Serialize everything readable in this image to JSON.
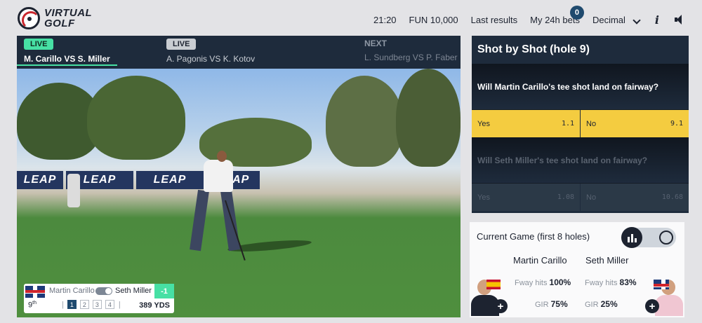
{
  "brand": {
    "line1": "VIRTUAL",
    "line2": "GOLF"
  },
  "header": {
    "time": "21:20",
    "balance": "FUN 10,000",
    "last_results": "Last results",
    "my_bets": "My 24h bets",
    "bets_count": "0",
    "odds_format": "Decimal",
    "icons": [
      "chevron-down-icon",
      "info-icon",
      "speaker-icon"
    ]
  },
  "games": [
    {
      "status": "LIVE",
      "name": "M. Carillo VS S. Miller",
      "active": true
    },
    {
      "status": "LIVE",
      "name": "A. Pagonis VS K. Kotov",
      "active": false
    },
    {
      "status": "NEXT",
      "name": "L. Sundberg VS P. Faber",
      "active": false
    }
  ],
  "video": {
    "banner_text": "LEAP",
    "score": {
      "player1": "Martin Carillo",
      "player2": "Seth Miller",
      "score": "-1",
      "hole": "9",
      "hole_suffix": "th",
      "rounds": [
        "1",
        "2",
        "3",
        "4"
      ],
      "distance": "389 YDS"
    }
  },
  "shot_by_shot": {
    "title": "Shot by Shot (hole 9)",
    "markets": [
      {
        "question": "Will Martin Carillo's tee shot land on fairway?",
        "yes_label": "Yes",
        "yes_price": "1.1",
        "no_label": "No",
        "no_price": "9.1"
      },
      {
        "question": "Will Seth Miller's tee shot land on fairway?",
        "yes_label": "Yes",
        "yes_price": "1.08",
        "no_label": "No",
        "no_price": "10.68"
      }
    ]
  },
  "current_game": {
    "title": "Current Game (first 8 holes)",
    "players": [
      {
        "name": "Martin Carillo",
        "fway_label": "Fway hits",
        "fway": "100%",
        "gir_label": "GIR",
        "gir": "75%"
      },
      {
        "name": "Seth Miller",
        "fway_label": "Fway hits",
        "fway": "83%",
        "gir_label": "GIR",
        "gir": "25%"
      }
    ],
    "plus": "+"
  },
  "colors": {
    "accent": "#47e0a4",
    "navy": "#1e2b3c",
    "odds_yellow": "#f4cc40"
  }
}
